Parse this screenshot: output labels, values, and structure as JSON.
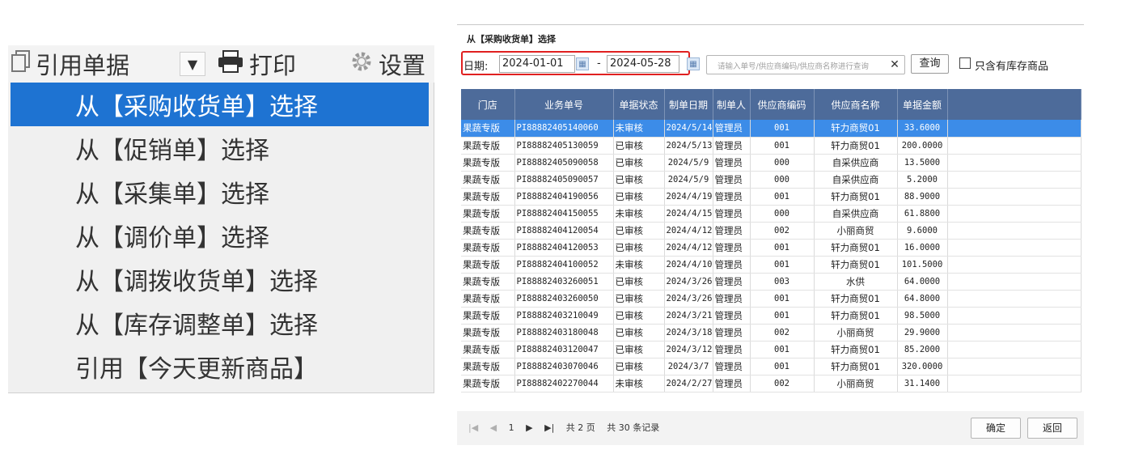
{
  "toolbar": {
    "quote_label": "引用单据",
    "quote_dropdown": "▼",
    "print_label": "打印",
    "settings_label": "设置"
  },
  "menu": {
    "items": [
      {
        "label": "从【采购收货单】选择",
        "selected": true
      },
      {
        "label": "从【促销单】选择",
        "selected": false
      },
      {
        "label": "从【采集单】选择",
        "selected": false
      },
      {
        "label": "从【调价单】选择",
        "selected": false
      },
      {
        "label": "从【调拨收货单】选择",
        "selected": false
      },
      {
        "label": "从【库存调整单】选择",
        "selected": false
      },
      {
        "label": "引用【今天更新商品】",
        "selected": false
      }
    ]
  },
  "dialog": {
    "title": "从【采购收货单】选择",
    "date_label": "日期:",
    "date_from": "2024-01-01",
    "date_sep": "-",
    "date_to": "2024-05-28",
    "search_placeholder": "请输入单号/供应商编码/供应商名称进行查询",
    "clear_symbol": "✕",
    "query_label": "查询",
    "stock_only_label": "只含有库存商品",
    "stock_only_checked": false
  },
  "table": {
    "columns": [
      "门店",
      "业务单号",
      "单据状态",
      "制单日期",
      "制单人",
      "供应商编码",
      "供应商名称",
      "单据金额"
    ],
    "rows": [
      [
        "果蔬专版",
        "PI88882405140060",
        "未审核",
        "2024/5/14",
        "管理员",
        "001",
        "轩力商贸01",
        "33.6000"
      ],
      [
        "果蔬专版",
        "PI88882405130059",
        "已审核",
        "2024/5/13",
        "管理员",
        "001",
        "轩力商贸01",
        "200.0000"
      ],
      [
        "果蔬专版",
        "PI88882405090058",
        "已审核",
        "2024/5/9",
        "管理员",
        "000",
        "自采供应商",
        "13.5000"
      ],
      [
        "果蔬专版",
        "PI88882405090057",
        "已审核",
        "2024/5/9",
        "管理员",
        "000",
        "自采供应商",
        "5.2000"
      ],
      [
        "果蔬专版",
        "PI88882404190056",
        "已审核",
        "2024/4/19",
        "管理员",
        "001",
        "轩力商贸01",
        "88.9000"
      ],
      [
        "果蔬专版",
        "PI88882404150055",
        "未审核",
        "2024/4/15",
        "管理员",
        "000",
        "自采供应商",
        "61.8800"
      ],
      [
        "果蔬专版",
        "PI88882404120054",
        "已审核",
        "2024/4/12",
        "管理员",
        "002",
        "小丽商贸",
        "9.6000"
      ],
      [
        "果蔬专版",
        "PI88882404120053",
        "已审核",
        "2024/4/12",
        "管理员",
        "001",
        "轩力商贸01",
        "16.0000"
      ],
      [
        "果蔬专版",
        "PI88882404100052",
        "未审核",
        "2024/4/10",
        "管理员",
        "001",
        "轩力商贸01",
        "101.5000"
      ],
      [
        "果蔬专版",
        "PI88882403260051",
        "已审核",
        "2024/3/26",
        "管理员",
        "003",
        "水供",
        "64.0000"
      ],
      [
        "果蔬专版",
        "PI88882403260050",
        "已审核",
        "2024/3/26",
        "管理员",
        "001",
        "轩力商贸01",
        "64.8000"
      ],
      [
        "果蔬专版",
        "PI88882403210049",
        "已审核",
        "2024/3/21",
        "管理员",
        "001",
        "轩力商贸01",
        "98.5000"
      ],
      [
        "果蔬专版",
        "PI88882403180048",
        "已审核",
        "2024/3/18",
        "管理员",
        "002",
        "小丽商贸",
        "29.9000"
      ],
      [
        "果蔬专版",
        "PI88882403120047",
        "已审核",
        "2024/3/12",
        "管理员",
        "001",
        "轩力商贸01",
        "85.2000"
      ],
      [
        "果蔬专版",
        "PI88882403070046",
        "已审核",
        "2024/3/7",
        "管理员",
        "001",
        "轩力商贸01",
        "320.0000"
      ],
      [
        "果蔬专版",
        "PI88882402270044",
        "未审核",
        "2024/2/27",
        "管理员",
        "002",
        "小丽商贸",
        "31.1400"
      ]
    ],
    "selected_row": 0
  },
  "pager": {
    "current_page": "1",
    "total_pages_text": "共 2 页",
    "total_records_text": "共 30 条记录"
  },
  "footer": {
    "ok_label": "确定",
    "back_label": "返回"
  },
  "colors": {
    "menu_selected_bg": "#1e73d2",
    "header_bg": "#4d6b9a",
    "row_selected_bg": "#3c8ce8",
    "highlight_border": "#e02020"
  }
}
